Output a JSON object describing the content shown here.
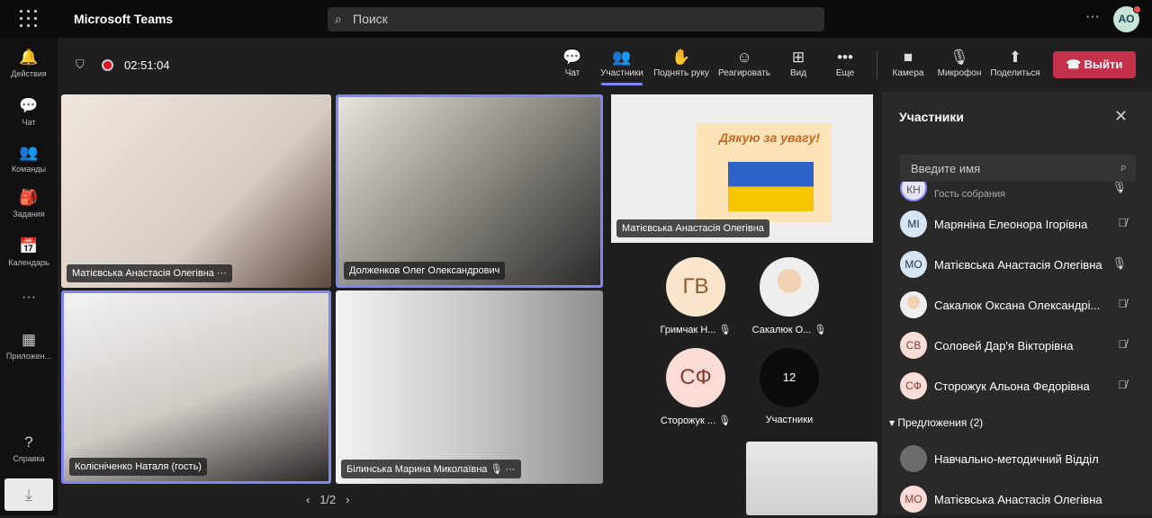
{
  "app": {
    "title": "Microsoft Teams",
    "search_placeholder": "Поиск",
    "more": "···",
    "user_initials": "AO"
  },
  "rail": [
    {
      "label": "Действия",
      "icon": "bell-icon",
      "glyph": "🔔"
    },
    {
      "label": "Чат",
      "icon": "chat-icon",
      "glyph": "💬"
    },
    {
      "label": "Команды",
      "icon": "teams-icon",
      "glyph": "👥"
    },
    {
      "label": "Задания",
      "icon": "assignments-icon",
      "glyph": "🎒"
    },
    {
      "label": "Календарь",
      "icon": "calendar-icon",
      "glyph": "📅"
    },
    {
      "label": "Приложен...",
      "icon": "apps-icon",
      "glyph": "▦"
    },
    {
      "label": "Справка",
      "icon": "help-icon",
      "glyph": "?"
    }
  ],
  "meeting": {
    "timer": "02:51:04",
    "toolbar": [
      {
        "label": "Чат",
        "icon": "chat-icon",
        "glyph": "☺"
      },
      {
        "label": "Участники",
        "icon": "people-icon",
        "glyph": "👥"
      },
      {
        "label": "Поднять руку",
        "icon": "hand-icon",
        "glyph": "✋"
      },
      {
        "label": "Реагировать",
        "icon": "smile-icon",
        "glyph": "☺"
      },
      {
        "label": "Вид",
        "icon": "grid-icon",
        "glyph": "⊞"
      },
      {
        "label": "Еще",
        "icon": "more-icon",
        "glyph": "•••"
      },
      {
        "label": "Камера",
        "icon": "camera-icon",
        "glyph": "■"
      },
      {
        "label": "Микрофон",
        "icon": "mic-off-icon",
        "glyph": "🎙"
      },
      {
        "label": "Поделиться",
        "icon": "share-icon",
        "glyph": "⬆"
      }
    ],
    "leave": "Выйти"
  },
  "videos": [
    {
      "name": "Матієвська Анастасія Олегівна",
      "more": "···"
    },
    {
      "name": "Долженков Олег Олександрович"
    },
    {
      "name": "Колісніченко Наталя (гость)"
    },
    {
      "name": "Білинська Марина Миколаївна",
      "more": "···"
    }
  ],
  "pager": {
    "prev": "‹",
    "page": "1/2",
    "next": "›"
  },
  "shared": {
    "presenter": "Матієвська Анастасія Олегівна",
    "slide_title": "Дякую за увагу!"
  },
  "tiles": [
    {
      "initials": "ГВ",
      "name": "Гримчак Н...",
      "bg": "#fbe6cd",
      "fg": "#8a5a2a"
    },
    {
      "initials": "",
      "name": "Сакалюк О...",
      "bg": "#e8dccf",
      "fg": "#333"
    },
    {
      "initials": "СФ",
      "name": "Сторожук ...",
      "bg": "#fbdcd7",
      "fg": "#8c3b2b"
    },
    {
      "initials": "12",
      "name": "Участники",
      "bg": "#0b0b0b",
      "fg": "#fff"
    }
  ],
  "panel": {
    "title": "Участники",
    "search_placeholder": "Введите имя",
    "participants": [
      {
        "initials": "КН",
        "name": "",
        "sub": "Гость собрания",
        "mic": "on",
        "bg": "#e6e3f5"
      },
      {
        "initials": "МІ",
        "name": "Маряніна Елеонора Ігорівна",
        "mic": "off",
        "bg": "#d6e4f3"
      },
      {
        "initials": "МО",
        "name": "Матієвська Анастасія Олегівна",
        "mic": "on",
        "bg": "#d6e4f3"
      },
      {
        "initials": "",
        "name": "Сакалюк Оксана Олександрі...",
        "mic": "off",
        "bg": "#e8dccf"
      },
      {
        "initials": "СВ",
        "name": "Соловей Дар'я Вікторівна",
        "mic": "off",
        "bg": "#fbdcd7"
      },
      {
        "initials": "СФ",
        "name": "Сторожук Альона Федорівна",
        "mic": "off",
        "bg": "#fbdcd7"
      }
    ],
    "suggestions_label": "Предложения (2)",
    "suggestions": [
      {
        "initials": "",
        "name": "Навчально-методичний Відділ",
        "bg": "#6b6b6b"
      },
      {
        "initials": "МО",
        "name": "Матієвська Анастасія Олегівна",
        "bg": "#fbdcd7"
      }
    ]
  }
}
